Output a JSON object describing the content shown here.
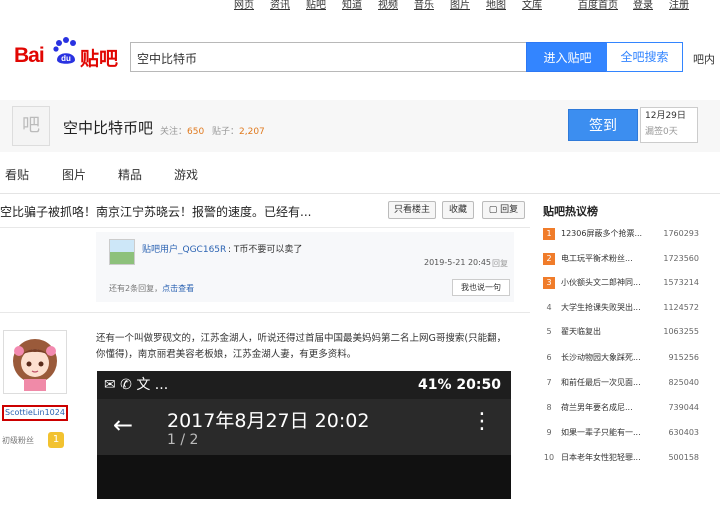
{
  "topnav": [
    "网页",
    "资讯",
    "贴吧",
    "知道",
    "视频",
    "音乐",
    "图片",
    "地图",
    "文库",
    "百度首页",
    "登录",
    "注册"
  ],
  "logo": {
    "bai": "Bai",
    "du": "du",
    "tieba": "贴吧"
  },
  "search": {
    "value": "空中比特币",
    "enter_label": "进入贴吧",
    "all_label": "全吧搜索",
    "more": "吧内"
  },
  "forum": {
    "fav_glyph": "吧",
    "name": "空中比特币吧",
    "follow_label": "关注：",
    "follow_count": "650",
    "posts_label": "贴子：",
    "posts_count": "2,207",
    "sign_label": "签到",
    "sign_date": "12月29日",
    "sign_count": "漏签0天"
  },
  "tabs": [
    "看贴",
    "图片",
    "精品",
    "游戏"
  ],
  "thread": {
    "title": "空比骗子被抓咯！南京江宁苏晓云！报警的速度。已经有...",
    "buttons": [
      "只看楼主",
      "收藏",
      "回复"
    ]
  },
  "lzl": {
    "user": "贴吧用户_QGC165R",
    "text": ": T币不要可以卖了",
    "time": "2019-5-21 20:45",
    "reply": "回复",
    "more_prefix": "还有2条回复，",
    "more_link": "点击查看",
    "say": "我也说一句"
  },
  "author": {
    "name": "ScottieLin1024",
    "level": "初级粉丝",
    "level_num": "1"
  },
  "post": {
    "text": "还有一个叫做罗砚文的，江苏金湖人，听说还得过首届中国最美妈妈第二名上网G哥搜索(只能翻，你懂得)，南京丽君美容老板娘，江苏金湖人妻，有更多资料。"
  },
  "phone": {
    "status_left": "✉ ✆ 文 ...",
    "status_right": "41% 20:50",
    "date": "2017年8月27日 20:02",
    "page": "1 / 2"
  },
  "hot": {
    "title": "贴吧热议榜",
    "items": [
      {
        "rank": "1",
        "title": "12306屏蔽多个抢票...",
        "count": "1760293"
      },
      {
        "rank": "2",
        "title": "电工玩平衡术粉丝...",
        "count": "1723560"
      },
      {
        "rank": "3",
        "title": "小伙额头文二郎神同...",
        "count": "1573214"
      },
      {
        "rank": "4",
        "title": "大学生抢课失败哭出...",
        "count": "1124572"
      },
      {
        "rank": "5",
        "title": "翟天临复出",
        "count": "1063255"
      },
      {
        "rank": "6",
        "title": "长沙动物园大象踩死...",
        "count": "915256"
      },
      {
        "rank": "7",
        "title": "和前任最后一次见面...",
        "count": "825040"
      },
      {
        "rank": "8",
        "title": "荷兰男年要名成尼...",
        "count": "739044"
      },
      {
        "rank": "9",
        "title": "如果一辈子只能有一...",
        "count": "630403"
      },
      {
        "rank": "10",
        "title": "日本老年女性犯轻罪...",
        "count": "500158"
      }
    ]
  }
}
